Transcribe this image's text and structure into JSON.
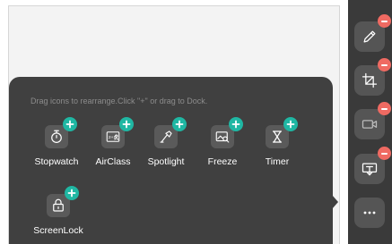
{
  "tray": {
    "hint": "Drag icons to rearrange.Click \"+\" or drag to Dock.",
    "apps": [
      {
        "label": "Stopwatch",
        "icon": "stopwatch-icon"
      },
      {
        "label": "AirClass",
        "icon": "airclass-icon"
      },
      {
        "label": "Spotlight",
        "icon": "spotlight-icon"
      },
      {
        "label": "Freeze",
        "icon": "freeze-icon"
      },
      {
        "label": "Timer",
        "icon": "hourglass-icon"
      },
      {
        "label": "ScreenLock",
        "icon": "lock-icon"
      }
    ]
  },
  "dock": {
    "items": [
      {
        "icon": "pen-icon"
      },
      {
        "icon": "crop-icon"
      },
      {
        "icon": "camera-icon"
      },
      {
        "icon": "cast-icon"
      },
      {
        "icon": "more-icon"
      }
    ]
  },
  "colors": {
    "panel": "#404040",
    "dock": "#3a3a3a",
    "add_badge": "#1fb7a3",
    "remove_badge": "#ef6a62"
  }
}
